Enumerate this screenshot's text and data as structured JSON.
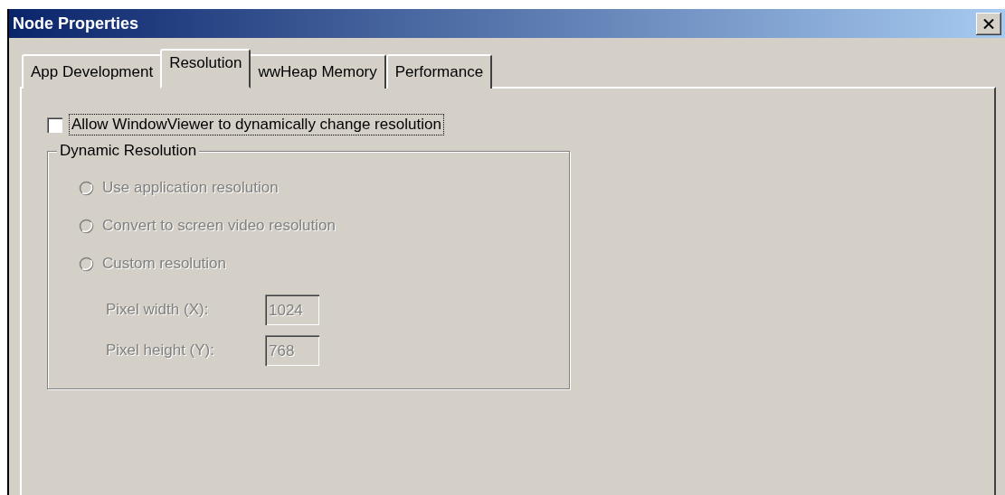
{
  "window": {
    "title": "Node Properties"
  },
  "tabs": [
    {
      "label": "App Development",
      "selected": false
    },
    {
      "label": "Resolution",
      "selected": true
    },
    {
      "label": "wwHeap Memory",
      "selected": false
    },
    {
      "label": "Performance",
      "selected": false
    }
  ],
  "checkbox": {
    "label": "Allow WindowViewer to dynamically change resolution",
    "checked": false,
    "focused": true
  },
  "group": {
    "title": "Dynamic Resolution",
    "radios": [
      {
        "label": "Use application resolution",
        "selected": false,
        "disabled": true
      },
      {
        "label": "Convert to screen video resolution",
        "selected": false,
        "disabled": true
      },
      {
        "label": "Custom resolution",
        "selected": false,
        "disabled": true
      }
    ],
    "fields": [
      {
        "label": "Pixel width (X):",
        "value": "1024",
        "disabled": true
      },
      {
        "label": "Pixel height (Y):",
        "value": "768",
        "disabled": true
      }
    ]
  }
}
